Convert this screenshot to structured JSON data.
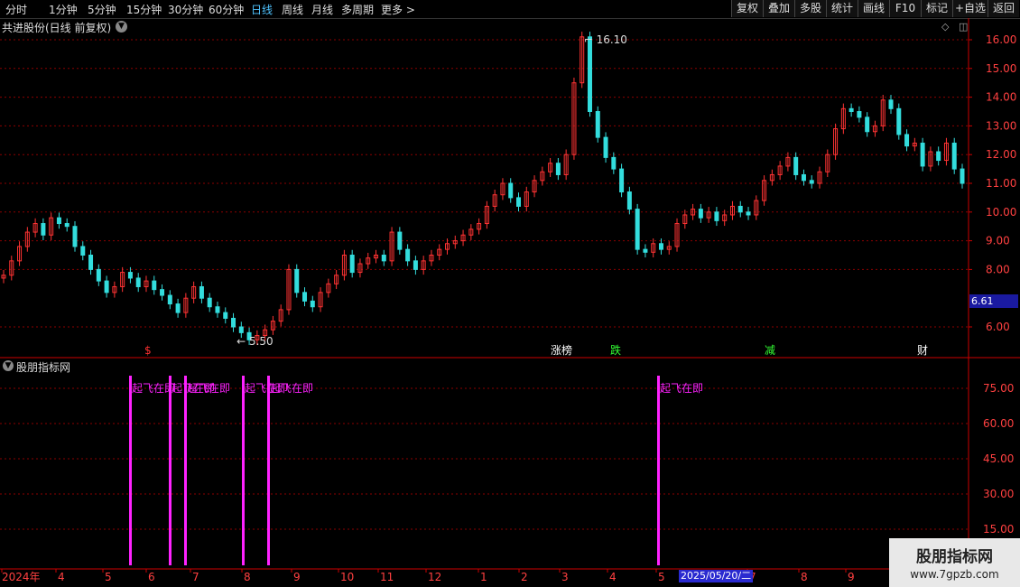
{
  "toolbar": {
    "periods": [
      "分时",
      "1分钟",
      "5分钟",
      "15分钟",
      "30分钟",
      "60分钟",
      "日线",
      "周线",
      "月线",
      "多周期",
      "更多 >"
    ],
    "active_period": "日线",
    "buttons": [
      "复权",
      "叠加",
      "多股",
      "统计",
      "画线",
      "F10",
      "标记",
      "+自选",
      "返回"
    ]
  },
  "chart": {
    "title": "共进股份(日线 前复权)",
    "price_ticks": [
      "16.00",
      "15.00",
      "14.00",
      "13.00",
      "12.00",
      "11.00",
      "10.00",
      "9.00",
      "8.00",
      "6.00"
    ],
    "current_price": "6.61",
    "max_label": "16.10",
    "min_label": "5.50",
    "event_markers": [
      {
        "text": "$",
        "color": "#ff3030"
      },
      {
        "text": "涨榜",
        "color": "#ffffff"
      },
      {
        "text": "跌",
        "color": "#33ff33"
      },
      {
        "text": "减",
        "color": "#33ff33"
      },
      {
        "text": "财",
        "color": "#ffffff"
      }
    ]
  },
  "indicator": {
    "title": "股朋指标网",
    "ticks": [
      "75.00",
      "60.00",
      "45.00",
      "30.00",
      "15.00"
    ],
    "signal_label": "起飞在即",
    "signal_color": "#ff22ff"
  },
  "x_axis": {
    "labels": [
      "2024年",
      "4",
      "5",
      "6",
      "7",
      "8",
      "9",
      "10",
      "11",
      "12",
      "1",
      "2",
      "3",
      "4",
      "5",
      "7",
      "8",
      "9"
    ],
    "cursor_date": "2025/05/20/二"
  },
  "watermark": {
    "title": "股朋指标网",
    "url": "www.7gpzb.com"
  },
  "colors": {
    "up": "#ff3333",
    "down": "#33dddd",
    "grid": "#8b0000",
    "axis": "#cc0000"
  },
  "chart_data": {
    "type": "candlestick",
    "title": "共进股份(日线 前复权)",
    "y_range": [
      5.2,
      16.6
    ],
    "max_point": 16.1,
    "min_point": 5.5,
    "last_close": 6.61,
    "closes": [
      7.8,
      8.3,
      8.8,
      9.3,
      9.6,
      9.2,
      9.8,
      9.6,
      9.5,
      8.8,
      8.5,
      8.0,
      7.6,
      7.2,
      7.4,
      7.9,
      7.7,
      7.4,
      7.6,
      7.3,
      7.1,
      6.8,
      6.5,
      7.0,
      7.4,
      7.0,
      6.7,
      6.5,
      6.3,
      6.0,
      5.8,
      5.55,
      5.7,
      5.9,
      6.2,
      6.6,
      8.0,
      7.2,
      6.9,
      6.7,
      7.2,
      7.5,
      7.8,
      8.5,
      7.9,
      8.2,
      8.4,
      8.5,
      8.3,
      9.3,
      8.7,
      8.3,
      8.0,
      8.3,
      8.5,
      8.7,
      8.9,
      9.0,
      9.2,
      9.4,
      9.6,
      10.2,
      10.6,
      11.0,
      10.5,
      10.2,
      10.7,
      11.1,
      11.4,
      11.7,
      11.3,
      12.0,
      14.5,
      16.1,
      13.5,
      12.6,
      11.9,
      11.5,
      10.7,
      10.1,
      8.7,
      8.6,
      8.9,
      8.7,
      8.8,
      9.6,
      9.9,
      10.1,
      9.8,
      10.0,
      9.7,
      9.9,
      10.2,
      10.0,
      9.9,
      10.4,
      11.1,
      11.3,
      11.6,
      11.9,
      11.3,
      11.1,
      11.0,
      11.4,
      12.0,
      12.9,
      13.6,
      13.5,
      13.3,
      12.8,
      13.0,
      13.9,
      13.6,
      12.7,
      12.3,
      12.4,
      11.6,
      12.1,
      11.8,
      12.4,
      11.5,
      11.0
    ]
  }
}
